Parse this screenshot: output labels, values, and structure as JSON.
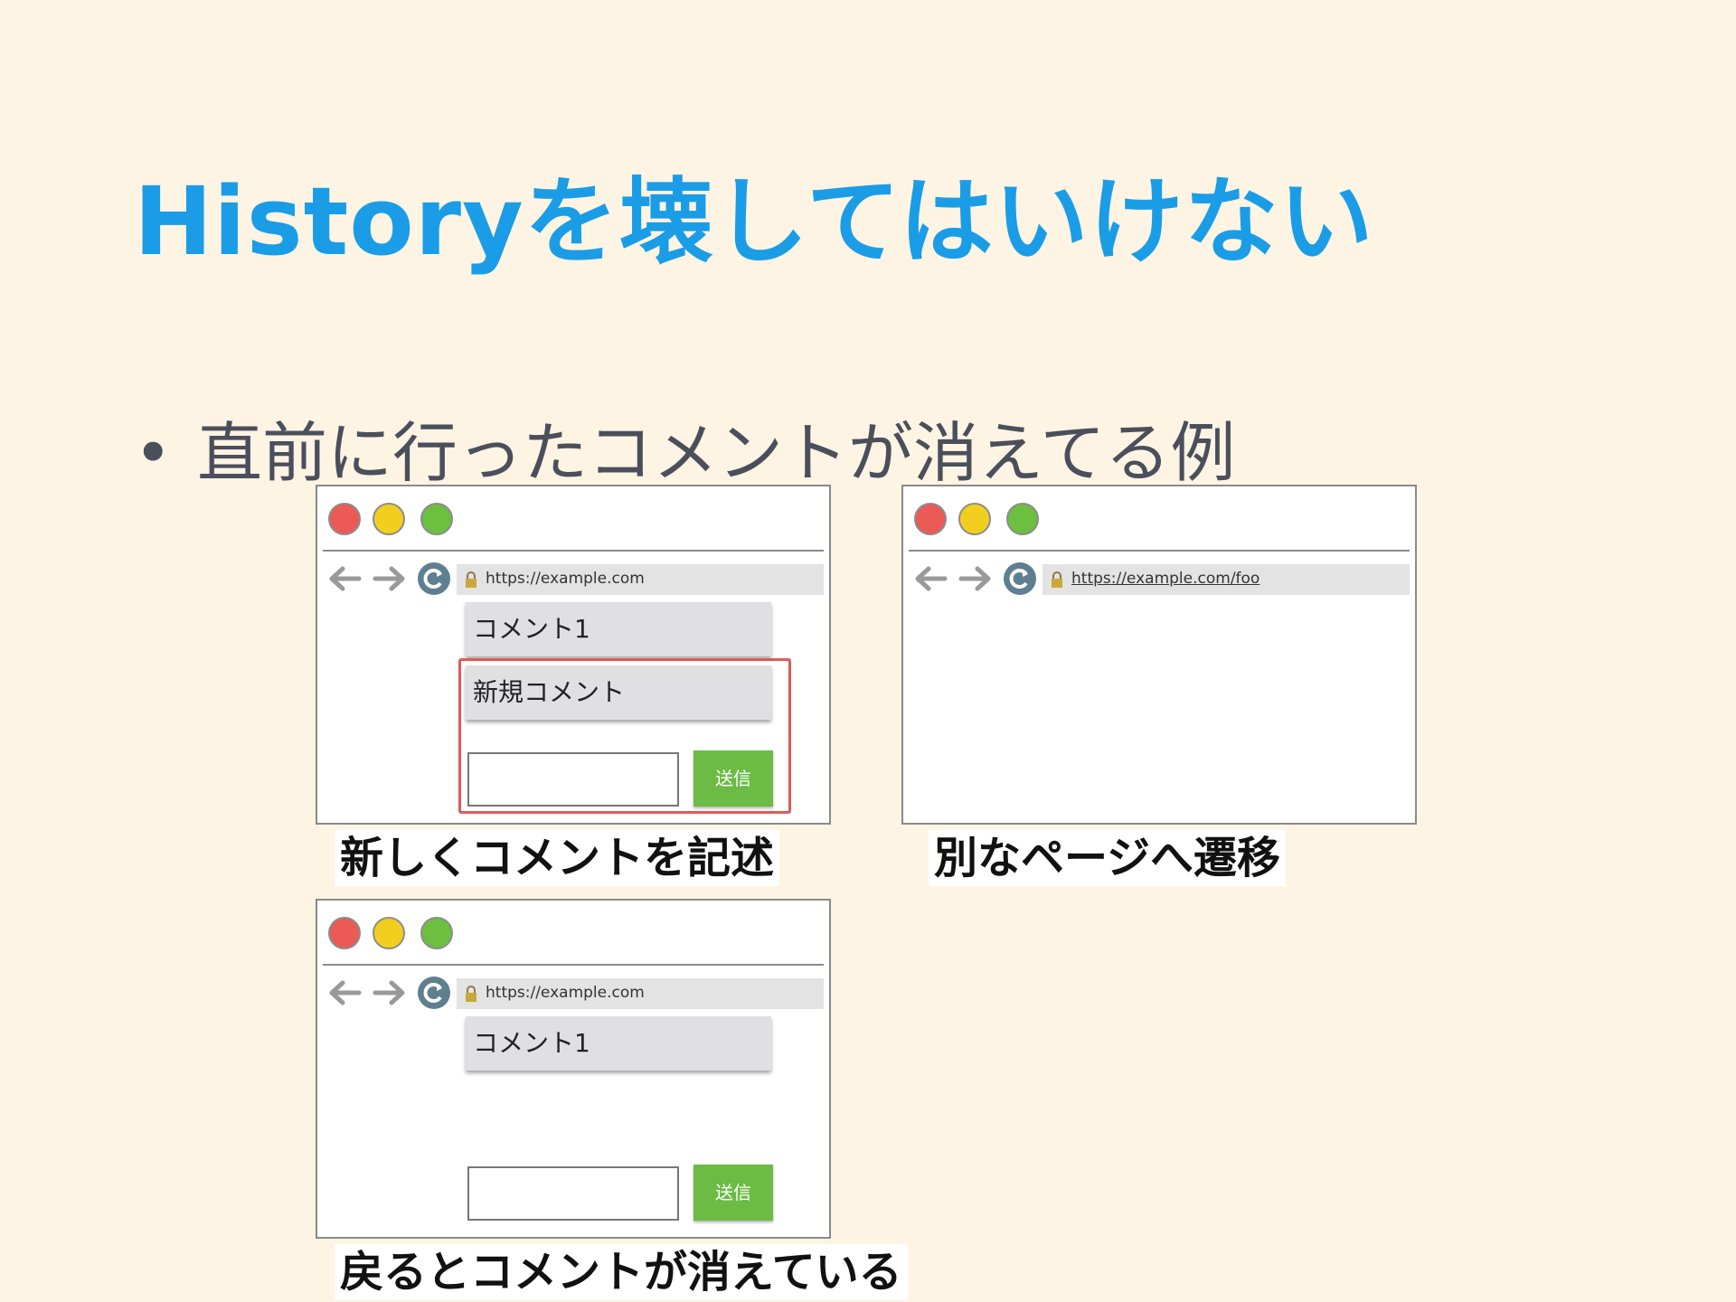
{
  "slide": {
    "title": "Historyを壊してはいけない",
    "bullet": "直前に行ったコメントが消えてる例"
  },
  "browsers": [
    {
      "url": "https://example.com",
      "comments": [
        "コメント1",
        "新規コメント"
      ],
      "send_label": "送信",
      "caption": "新しくコメントを記述"
    },
    {
      "url": "https://example.com/foo",
      "caption": "別なページへ遷移"
    },
    {
      "url": "https://example.com",
      "comments": [
        "コメント1"
      ],
      "send_label": "送信",
      "caption": "戻るとコメントが消えている"
    }
  ],
  "colors": {
    "background": "#fdf4e3",
    "title": "#1a9de6",
    "send_button": "#6bbb45",
    "highlight": "#e05a5a"
  }
}
